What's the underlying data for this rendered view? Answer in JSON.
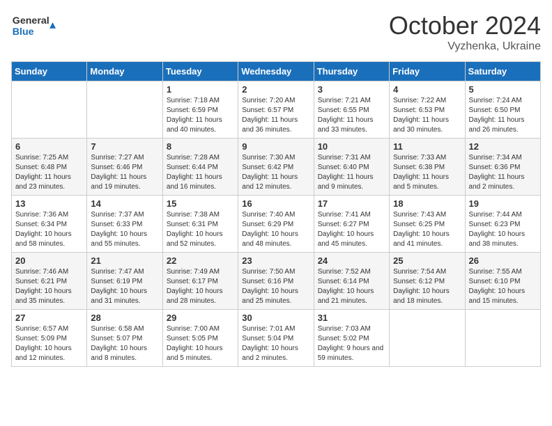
{
  "header": {
    "logo_line1": "General",
    "logo_line2": "Blue",
    "title": "October 2024",
    "subtitle": "Vyzhenka, Ukraine"
  },
  "weekdays": [
    "Sunday",
    "Monday",
    "Tuesday",
    "Wednesday",
    "Thursday",
    "Friday",
    "Saturday"
  ],
  "weeks": [
    [
      {
        "day": "",
        "info": ""
      },
      {
        "day": "",
        "info": ""
      },
      {
        "day": "1",
        "info": "Sunrise: 7:18 AM\nSunset: 6:59 PM\nDaylight: 11 hours and 40 minutes."
      },
      {
        "day": "2",
        "info": "Sunrise: 7:20 AM\nSunset: 6:57 PM\nDaylight: 11 hours and 36 minutes."
      },
      {
        "day": "3",
        "info": "Sunrise: 7:21 AM\nSunset: 6:55 PM\nDaylight: 11 hours and 33 minutes."
      },
      {
        "day": "4",
        "info": "Sunrise: 7:22 AM\nSunset: 6:53 PM\nDaylight: 11 hours and 30 minutes."
      },
      {
        "day": "5",
        "info": "Sunrise: 7:24 AM\nSunset: 6:50 PM\nDaylight: 11 hours and 26 minutes."
      }
    ],
    [
      {
        "day": "6",
        "info": "Sunrise: 7:25 AM\nSunset: 6:48 PM\nDaylight: 11 hours and 23 minutes."
      },
      {
        "day": "7",
        "info": "Sunrise: 7:27 AM\nSunset: 6:46 PM\nDaylight: 11 hours and 19 minutes."
      },
      {
        "day": "8",
        "info": "Sunrise: 7:28 AM\nSunset: 6:44 PM\nDaylight: 11 hours and 16 minutes."
      },
      {
        "day": "9",
        "info": "Sunrise: 7:30 AM\nSunset: 6:42 PM\nDaylight: 11 hours and 12 minutes."
      },
      {
        "day": "10",
        "info": "Sunrise: 7:31 AM\nSunset: 6:40 PM\nDaylight: 11 hours and 9 minutes."
      },
      {
        "day": "11",
        "info": "Sunrise: 7:33 AM\nSunset: 6:38 PM\nDaylight: 11 hours and 5 minutes."
      },
      {
        "day": "12",
        "info": "Sunrise: 7:34 AM\nSunset: 6:36 PM\nDaylight: 11 hours and 2 minutes."
      }
    ],
    [
      {
        "day": "13",
        "info": "Sunrise: 7:36 AM\nSunset: 6:34 PM\nDaylight: 10 hours and 58 minutes."
      },
      {
        "day": "14",
        "info": "Sunrise: 7:37 AM\nSunset: 6:33 PM\nDaylight: 10 hours and 55 minutes."
      },
      {
        "day": "15",
        "info": "Sunrise: 7:38 AM\nSunset: 6:31 PM\nDaylight: 10 hours and 52 minutes."
      },
      {
        "day": "16",
        "info": "Sunrise: 7:40 AM\nSunset: 6:29 PM\nDaylight: 10 hours and 48 minutes."
      },
      {
        "day": "17",
        "info": "Sunrise: 7:41 AM\nSunset: 6:27 PM\nDaylight: 10 hours and 45 minutes."
      },
      {
        "day": "18",
        "info": "Sunrise: 7:43 AM\nSunset: 6:25 PM\nDaylight: 10 hours and 41 minutes."
      },
      {
        "day": "19",
        "info": "Sunrise: 7:44 AM\nSunset: 6:23 PM\nDaylight: 10 hours and 38 minutes."
      }
    ],
    [
      {
        "day": "20",
        "info": "Sunrise: 7:46 AM\nSunset: 6:21 PM\nDaylight: 10 hours and 35 minutes."
      },
      {
        "day": "21",
        "info": "Sunrise: 7:47 AM\nSunset: 6:19 PM\nDaylight: 10 hours and 31 minutes."
      },
      {
        "day": "22",
        "info": "Sunrise: 7:49 AM\nSunset: 6:17 PM\nDaylight: 10 hours and 28 minutes."
      },
      {
        "day": "23",
        "info": "Sunrise: 7:50 AM\nSunset: 6:16 PM\nDaylight: 10 hours and 25 minutes."
      },
      {
        "day": "24",
        "info": "Sunrise: 7:52 AM\nSunset: 6:14 PM\nDaylight: 10 hours and 21 minutes."
      },
      {
        "day": "25",
        "info": "Sunrise: 7:54 AM\nSunset: 6:12 PM\nDaylight: 10 hours and 18 minutes."
      },
      {
        "day": "26",
        "info": "Sunrise: 7:55 AM\nSunset: 6:10 PM\nDaylight: 10 hours and 15 minutes."
      }
    ],
    [
      {
        "day": "27",
        "info": "Sunrise: 6:57 AM\nSunset: 5:09 PM\nDaylight: 10 hours and 12 minutes."
      },
      {
        "day": "28",
        "info": "Sunrise: 6:58 AM\nSunset: 5:07 PM\nDaylight: 10 hours and 8 minutes."
      },
      {
        "day": "29",
        "info": "Sunrise: 7:00 AM\nSunset: 5:05 PM\nDaylight: 10 hours and 5 minutes."
      },
      {
        "day": "30",
        "info": "Sunrise: 7:01 AM\nSunset: 5:04 PM\nDaylight: 10 hours and 2 minutes."
      },
      {
        "day": "31",
        "info": "Sunrise: 7:03 AM\nSunset: 5:02 PM\nDaylight: 9 hours and 59 minutes."
      },
      {
        "day": "",
        "info": ""
      },
      {
        "day": "",
        "info": ""
      }
    ]
  ]
}
